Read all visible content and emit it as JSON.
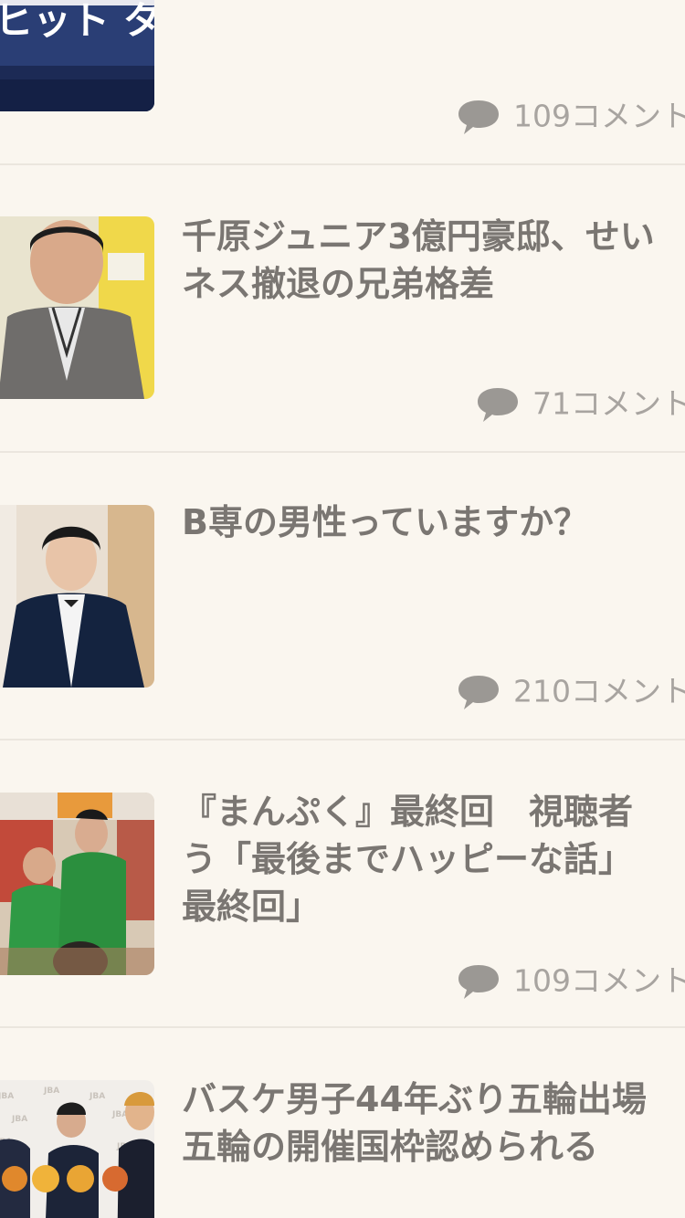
{
  "articles": [
    {
      "title_lines": [],
      "comment_count": "109",
      "comment_suffix": "コメント",
      "thumb_icon": "variety-show-logo-image",
      "thumb_text": "ヒット タジオ"
    },
    {
      "title_lines": [
        "千原ジュニア3億円豪邸、せい",
        "ネス撤退の兄弟格差"
      ],
      "comment_count": "71",
      "comment_suffix": "コメント",
      "thumb_icon": "comedian-portrait-image"
    },
    {
      "title_lines": [
        "B専の男性っていますか？"
      ],
      "comment_count": "210",
      "comment_suffix": "コメント",
      "thumb_icon": "man-in-suit-portrait-image"
    },
    {
      "title_lines": [
        "『まんぷく』最終回　視聴者",
        "う「最後までハッピーな話」",
        "最終回」"
      ],
      "comment_count": "109",
      "comment_suffix": "コメント",
      "thumb_icon": "cast-in-green-jackets-image"
    },
    {
      "title_lines": [
        "バスケ男子44年ぶり五輪出場",
        "五輪の開催国枠認められる"
      ],
      "comment_count": "",
      "comment_suffix": "",
      "thumb_icon": "basketball-press-event-image"
    }
  ]
}
